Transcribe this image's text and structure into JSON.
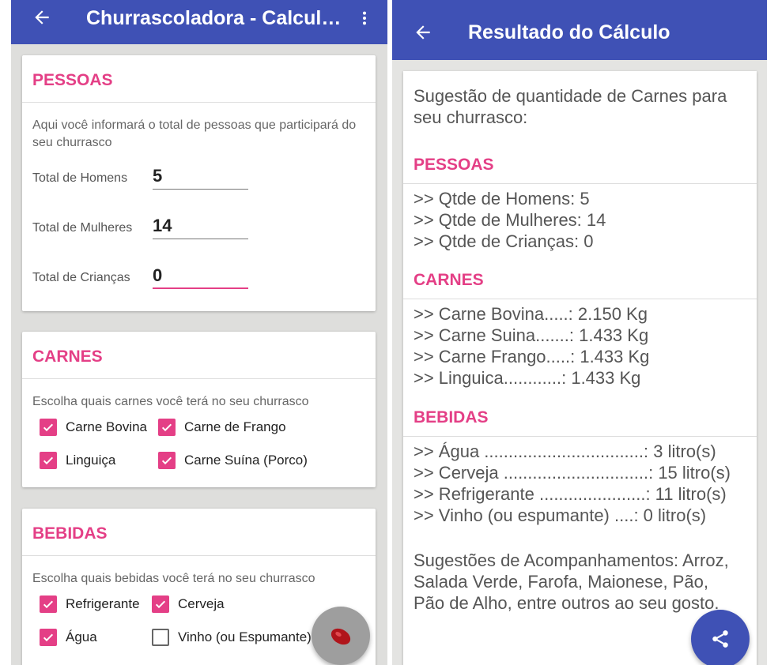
{
  "left": {
    "appbar": {
      "title": "Churrascoladora - Calculadora"
    },
    "pessoas": {
      "title": "PESSOAS",
      "desc": "Aqui você informará o total de pessoas que participará do seu churrasco",
      "fields": [
        {
          "label": "Total de Homens",
          "value": "5"
        },
        {
          "label": "Total de Mulheres",
          "value": "14"
        },
        {
          "label": "Total de Crianças",
          "value": "0"
        }
      ]
    },
    "carnes": {
      "title": "CARNES",
      "desc": "Escolha quais carnes você terá no seu churrasco",
      "options": [
        {
          "label": "Carne Bovina",
          "checked": true
        },
        {
          "label": "Carne de Frango",
          "checked": true
        },
        {
          "label": "Linguiça",
          "checked": true
        },
        {
          "label": "Carne Suína (Porco)",
          "checked": true
        }
      ]
    },
    "bebidas": {
      "title": "BEBIDAS",
      "desc": "Escolha quais bebidas você terá no seu churrasco",
      "options": [
        {
          "label": "Refrigerante",
          "checked": true
        },
        {
          "label": "Cerveja",
          "checked": true
        },
        {
          "label": "Água",
          "checked": true
        },
        {
          "label": "Vinho (ou Espumante)",
          "checked": false
        }
      ]
    },
    "fab": {
      "icon": "meat-icon"
    }
  },
  "right": {
    "appbar": {
      "title": "Resultado do Cálculo"
    },
    "intro": "Sugestão de quantidade de Carnes para seu churrasco:",
    "pessoas": {
      "title": "PESSOAS",
      "lines": [
        ">> Qtde de Homens: 5",
        ">> Qtde de Mulheres: 14",
        ">> Qtde de Crianças: 0"
      ]
    },
    "carnes": {
      "title": "CARNES",
      "lines": [
        ">> Carne Bovina.....: 2.150 Kg",
        ">> Carne Suina.......: 1.433 Kg",
        ">> Carne Frango.....: 1.433 Kg",
        ">> Linguica............: 1.433 Kg"
      ]
    },
    "bebidas": {
      "title": "BEBIDAS",
      "lines": [
        ">> Água .................................: 3 litro(s)",
        ">> Cerveja ..............................: 15 litro(s)",
        ">> Refrigerante ......................: 11 litro(s)",
        ">> Vinho (ou espumante) ....: 0 litro(s)"
      ]
    },
    "acompanhamentos": "Sugestões de Acompanhamentos: Arroz, Salada Verde, Farofa, Maionese, Pão, Pão de Alho, entre outros ao seu gosto.",
    "fab": {
      "icon": "share-icon"
    }
  },
  "colors": {
    "primary": "#3f51b5",
    "accent": "#e43f86",
    "background": "#dededc"
  }
}
